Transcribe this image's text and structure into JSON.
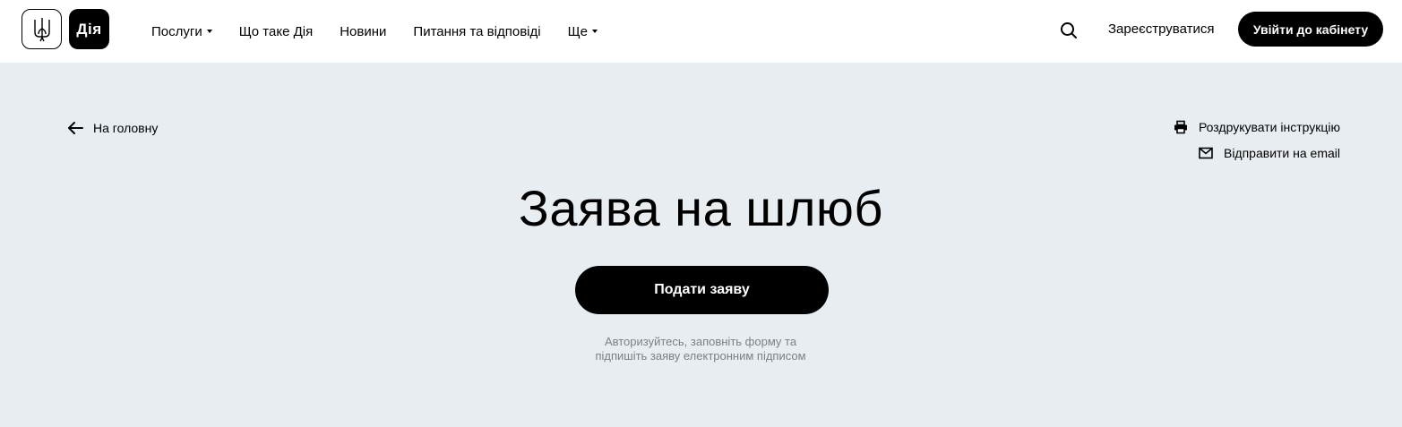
{
  "header": {
    "logo_text": "Дія",
    "nav": [
      {
        "label": "Послуги",
        "has_dropdown": true
      },
      {
        "label": "Що таке Дія",
        "has_dropdown": false
      },
      {
        "label": "Новини",
        "has_dropdown": false
      },
      {
        "label": "Питання та відповіді",
        "has_dropdown": false
      },
      {
        "label": "Ще",
        "has_dropdown": true
      }
    ],
    "register_label": "Зареєструватися",
    "login_label": "Увійти до кабінету"
  },
  "page": {
    "back_label": "На головну",
    "print_label": "Роздрукувати інструкцію",
    "email_label": "Відправити на email",
    "title": "Заява на шлюб",
    "submit_label": "Подати заяву",
    "hint_line1": "Авторизуйтесь, заповніть форму та",
    "hint_line2": "підпишіть заяву електронним підписом"
  },
  "colors": {
    "header_bg": "#ffffff",
    "page_bg": "#e8edf1",
    "primary": "#000000",
    "hint_text": "#7d8084"
  },
  "icons": [
    "trident-icon",
    "search-icon",
    "arrow-left-icon",
    "printer-icon",
    "mail-icon",
    "chevron-down-icon"
  ]
}
